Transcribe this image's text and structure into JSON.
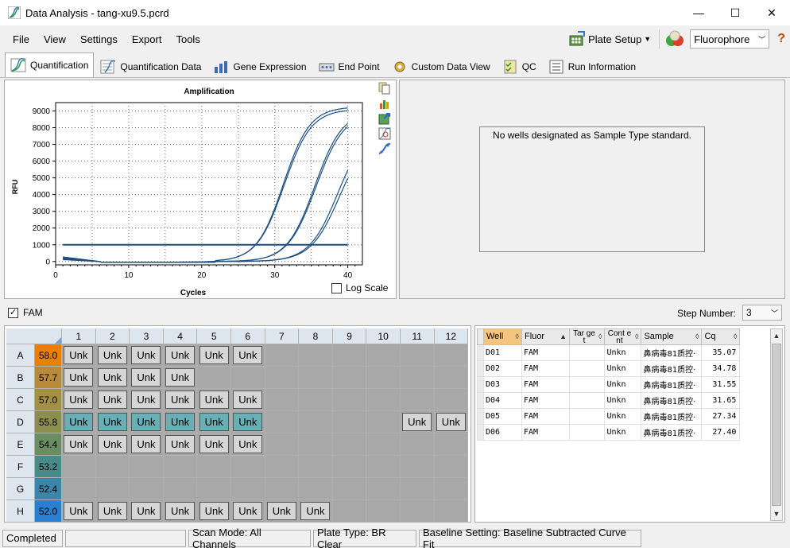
{
  "window": {
    "title": "Data Analysis - tang-xu9.5.pcrd",
    "minimize": "—",
    "maximize": "☐",
    "close": "✕"
  },
  "menu": {
    "items": [
      "File",
      "View",
      "Settings",
      "Export",
      "Tools"
    ],
    "plate_setup": "Plate Setup",
    "fluorophore": "Fluorophore",
    "help": "?"
  },
  "tabs": [
    "Quantification",
    "Quantification Data",
    "Gene Expression",
    "End Point",
    "Custom Data View",
    "QC",
    "Run Information"
  ],
  "chart": {
    "title": "Amplification",
    "xlabel": "Cycles",
    "ylabel": "RFU",
    "log_scale_label": "Log Scale",
    "log_scale_checked": false
  },
  "chart_data": {
    "type": "line",
    "title": "Amplification",
    "xlabel": "Cycles",
    "ylabel": "RFU",
    "xlim": [
      0,
      42
    ],
    "ylim": [
      -200,
      9500
    ],
    "x_ticks": [
      0,
      10,
      20,
      30,
      40
    ],
    "y_ticks": [
      0,
      1000,
      2000,
      3000,
      4000,
      5000,
      6000,
      7000,
      8000,
      9000
    ],
    "grid": true,
    "threshold": 1000,
    "series": [
      {
        "cq": 27.34,
        "plateau": 9250
      },
      {
        "cq": 27.4,
        "plateau": 9100
      },
      {
        "cq": 31.55,
        "plateau": 9000
      },
      {
        "cq": 31.65,
        "plateau": 8900
      },
      {
        "cq": 34.78,
        "plateau": 8200
      },
      {
        "cq": 35.07,
        "plateau": 7900
      }
    ]
  },
  "standard_panel": {
    "message": "No wells designated as Sample Type standard."
  },
  "fluor_bar": {
    "fam_label": "FAM",
    "fam_checked": true,
    "step_label": "Step Number:",
    "step_value": "3"
  },
  "plate": {
    "columns": [
      "1",
      "2",
      "3",
      "4",
      "5",
      "6",
      "7",
      "8",
      "9",
      "10",
      "11",
      "12"
    ],
    "rows": [
      {
        "label": "A",
        "temp": "58.0",
        "color": "#e88000",
        "wells": [
          "Unk",
          "Unk",
          "Unk",
          "Unk",
          "Unk",
          "Unk",
          "",
          "",
          "",
          "",
          "",
          ""
        ],
        "selected": []
      },
      {
        "label": "B",
        "temp": "57.7",
        "color": "#b88a3a",
        "wells": [
          "Unk",
          "Unk",
          "Unk",
          "Unk",
          "",
          "",
          "",
          "",
          "",
          "",
          "",
          ""
        ],
        "selected": []
      },
      {
        "label": "C",
        "temp": "57.0",
        "color": "#a49042",
        "wells": [
          "Unk",
          "Unk",
          "Unk",
          "Unk",
          "Unk",
          "Unk",
          "",
          "",
          "",
          "",
          "",
          ""
        ],
        "selected": []
      },
      {
        "label": "D",
        "temp": "55.8",
        "color": "#8a8f50",
        "wells": [
          "Unk",
          "Unk",
          "Unk",
          "Unk",
          "Unk",
          "Unk",
          "",
          "",
          "",
          "",
          "Unk",
          "Unk"
        ],
        "selected": [
          0,
          1,
          2,
          3,
          4,
          5
        ]
      },
      {
        "label": "E",
        "temp": "54.4",
        "color": "#6a8e60",
        "wells": [
          "Unk",
          "Unk",
          "Unk",
          "Unk",
          "Unk",
          "Unk",
          "",
          "",
          "",
          "",
          "",
          ""
        ],
        "selected": []
      },
      {
        "label": "F",
        "temp": "53.2",
        "color": "#4a8a88",
        "wells": [
          "",
          "",
          "",
          "",
          "",
          "",
          "",
          "",
          "",
          "",
          "",
          ""
        ],
        "selected": []
      },
      {
        "label": "G",
        "temp": "52.4",
        "color": "#3a86a8",
        "wells": [
          "",
          "",
          "",
          "",
          "",
          "",
          "",
          "",
          "",
          "",
          "",
          ""
        ],
        "selected": []
      },
      {
        "label": "H",
        "temp": "52.0",
        "color": "#2a80d0",
        "wells": [
          "Unk",
          "Unk",
          "Unk",
          "Unk",
          "Unk",
          "Unk",
          "Unk",
          "Unk",
          "",
          "",
          "",
          ""
        ],
        "selected": []
      }
    ]
  },
  "data_table": {
    "headers": [
      "Well",
      "Fluor",
      "Tar get",
      "Cont ent",
      "Sample",
      "Cq"
    ],
    "rows": [
      [
        "D01",
        "FAM",
        "",
        "Unkn",
        "鼻病毒81质控·",
        "35.07"
      ],
      [
        "D02",
        "FAM",
        "",
        "Unkn",
        "鼻病毒81质控·",
        "34.78"
      ],
      [
        "D03",
        "FAM",
        "",
        "Unkn",
        "鼻病毒81质控·",
        "31.55"
      ],
      [
        "D04",
        "FAM",
        "",
        "Unkn",
        "鼻病毒81质控·",
        "31.65"
      ],
      [
        "D05",
        "FAM",
        "",
        "Unkn",
        "鼻病毒81质控·",
        "27.34"
      ],
      [
        "D06",
        "FAM",
        "",
        "Unkn",
        "鼻病毒81质控·",
        "27.40"
      ]
    ]
  },
  "status": {
    "state": "Completed",
    "progress": "",
    "scan_mode": "Scan Mode: All Channels",
    "plate_type": "Plate Type: BR Clear",
    "baseline": "Baseline Setting: Baseline Subtracted Curve Fit"
  }
}
